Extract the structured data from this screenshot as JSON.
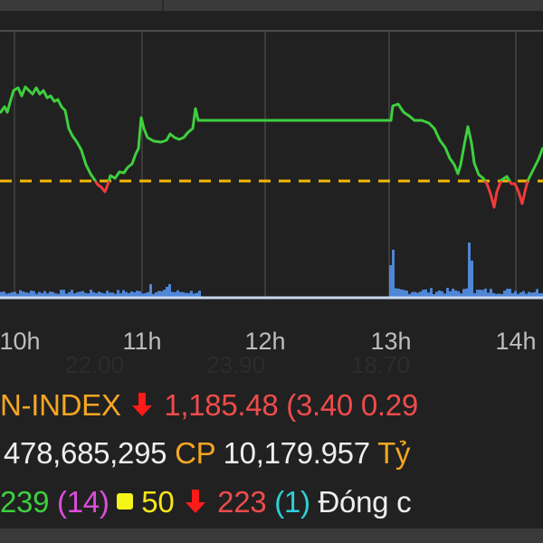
{
  "colors": {
    "up": "#3ecf3e",
    "down": "#ef3b3b",
    "reference": "#f2b705",
    "volume": "#4f86d6",
    "label": "#f5a623",
    "ceiling": "#d94fd9",
    "floor": "#2ed0d8",
    "unchanged": "#f5e61a"
  },
  "chart_data": {
    "type": "line",
    "x_ticks": [
      "10h",
      "11h",
      "12h",
      "13h",
      "14h"
    ],
    "reference_line": "dashed yellow (previous close)",
    "grid": true,
    "price_shape": "intraday index line, green above reference, red below; flat during lunch break 11:30-13:00",
    "volume_series": "blue histogram at bottom, spikes near 13h and ~13:40"
  },
  "ghost_values": [
    "22.00",
    "23.90",
    "18.70"
  ],
  "index": {
    "name": "N-INDEX",
    "direction_icon": "arrow-down-icon",
    "value": "1,185.48",
    "change": "(3.40 0.29"
  },
  "volume": {
    "shares": "478,685,295",
    "shares_unit": "CP",
    "value": "10,179.957",
    "value_unit": "Tỷ"
  },
  "breadth": {
    "up": "239",
    "ceiling": "(14)",
    "unchanged": "50",
    "down": "223",
    "floor": "(1)",
    "status": "Đóng c"
  }
}
